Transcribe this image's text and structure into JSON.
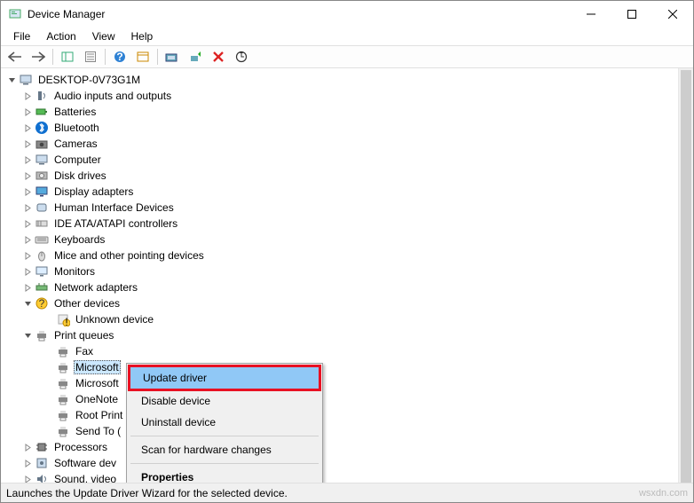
{
  "window": {
    "title": "Device Manager"
  },
  "menubar": [
    "File",
    "Action",
    "View",
    "Help"
  ],
  "root": "DESKTOP-0V73G1M",
  "categories": [
    {
      "label": "Audio inputs and outputs",
      "icon": "audio",
      "expanded": false
    },
    {
      "label": "Batteries",
      "icon": "battery",
      "expanded": false
    },
    {
      "label": "Bluetooth",
      "icon": "bluetooth",
      "expanded": false
    },
    {
      "label": "Cameras",
      "icon": "camera",
      "expanded": false
    },
    {
      "label": "Computer",
      "icon": "computer",
      "expanded": false
    },
    {
      "label": "Disk drives",
      "icon": "disk",
      "expanded": false
    },
    {
      "label": "Display adapters",
      "icon": "display",
      "expanded": false
    },
    {
      "label": "Human Interface Devices",
      "icon": "hid",
      "expanded": false
    },
    {
      "label": "IDE ATA/ATAPI controllers",
      "icon": "ide",
      "expanded": false
    },
    {
      "label": "Keyboards",
      "icon": "keyboard",
      "expanded": false
    },
    {
      "label": "Mice and other pointing devices",
      "icon": "mouse",
      "expanded": false
    },
    {
      "label": "Monitors",
      "icon": "monitor",
      "expanded": false
    },
    {
      "label": "Network adapters",
      "icon": "network",
      "expanded": false
    },
    {
      "label": "Other devices",
      "icon": "other",
      "expanded": true,
      "children": [
        {
          "label": "Unknown device",
          "icon": "unknown"
        }
      ]
    },
    {
      "label": "Print queues",
      "icon": "printer",
      "expanded": true,
      "children": [
        {
          "label": "Fax",
          "icon": "printer"
        },
        {
          "label": "Microsoft",
          "icon": "printer",
          "selected": true,
          "truncated": true
        },
        {
          "label": "Microsoft",
          "icon": "printer",
          "truncated": true
        },
        {
          "label": "OneNote",
          "icon": "printer",
          "truncated": true
        },
        {
          "label": "Root Print",
          "icon": "printer",
          "truncated": true
        },
        {
          "label": "Send To (",
          "icon": "printer",
          "truncated": true
        }
      ]
    },
    {
      "label": "Processors",
      "icon": "cpu",
      "expanded": false,
      "truncated": true
    },
    {
      "label": "Software dev",
      "icon": "software",
      "expanded": false,
      "truncated": true
    },
    {
      "label": "Sound, video",
      "icon": "sound",
      "expanded": false,
      "truncated": true
    }
  ],
  "contextmenu": {
    "items": [
      {
        "label": "Update driver",
        "highlight": true
      },
      {
        "label": "Disable device"
      },
      {
        "label": "Uninstall device"
      },
      {
        "sep": true
      },
      {
        "label": "Scan for hardware changes"
      },
      {
        "sep": true
      },
      {
        "label": "Properties",
        "bold": true
      }
    ]
  },
  "statusbar": "Launches the Update Driver Wizard for the selected device.",
  "watermark": "wsxdn.com"
}
